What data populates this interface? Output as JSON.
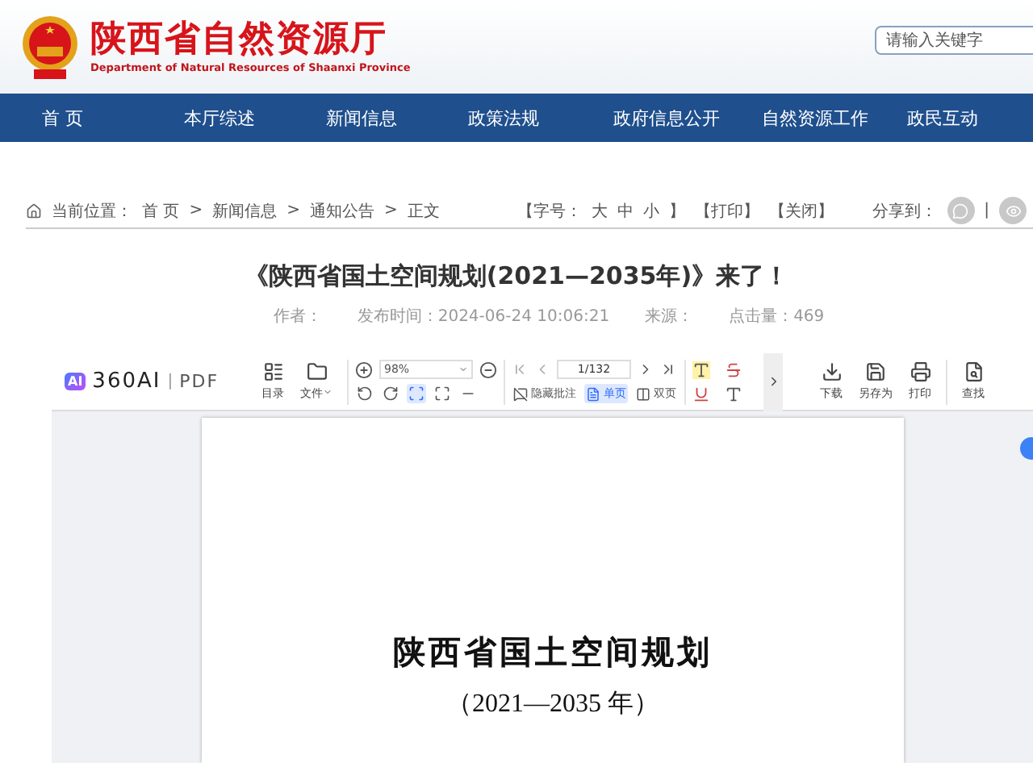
{
  "header": {
    "title": "陕西省自然资源厅",
    "subtitle": "Department of Natural Resources of Shaanxi Province",
    "search": {
      "placeholder": "请输入关键字"
    }
  },
  "nav": [
    {
      "label": "首 页"
    },
    {
      "label": "本厅综述"
    },
    {
      "label": "新闻信息"
    },
    {
      "label": "政策法规"
    },
    {
      "label": "政府信息公开"
    },
    {
      "label": "自然资源工作"
    },
    {
      "label": "政民互动"
    }
  ],
  "breadcrumb": {
    "label": "当前位置：",
    "separator": ">",
    "items": [
      "首 页",
      "新闻信息",
      "通知公告",
      "正文"
    ]
  },
  "tools": {
    "font_label": "【字号：",
    "sizes": [
      "大",
      "中",
      "小"
    ],
    "font_end": "】",
    "print": "【打印】",
    "close": "【关闭】",
    "share_label": "分享到：",
    "share_divider": "|"
  },
  "article": {
    "title": "《陕西省国土空间规划(2021—2035年)》来了！",
    "meta": [
      {
        "label": "作者："
      },
      {
        "label": "发布时间：",
        "value": "2024-06-24 10:06:21"
      },
      {
        "label": "来源："
      },
      {
        "label": "点击量：",
        "value": "469"
      }
    ]
  },
  "pdf": {
    "logo_badge": "AI",
    "logo_name": "360AI",
    "logo_divider": "|",
    "logo_suffix": "PDF",
    "file_buttons": [
      {
        "label": "目录",
        "kind": "toc"
      },
      {
        "label": "文件",
        "kind": "file"
      }
    ],
    "zoom": {
      "value": "98%"
    },
    "fit_buttons": [
      {
        "kind": "rotate-left",
        "selected": false
      },
      {
        "kind": "rotate-right",
        "selected": false
      },
      {
        "kind": "actual",
        "selected": true
      },
      {
        "kind": "fit",
        "selected": false
      },
      {
        "kind": "width",
        "selected": false
      }
    ],
    "page_field": {
      "value": "1/132"
    },
    "view_buttons": [
      {
        "label": "隐藏批注",
        "kind": "annot",
        "selected": false
      },
      {
        "label": "单页",
        "kind": "single",
        "selected": true
      },
      {
        "label": "双页",
        "kind": "double",
        "selected": false
      }
    ],
    "text_tools": [
      {
        "kind": "highlight"
      },
      {
        "kind": "strike"
      },
      {
        "kind": "underline"
      },
      {
        "kind": "plain"
      }
    ],
    "actions": [
      {
        "label": "下载",
        "kind": "download"
      },
      {
        "label": "另存为",
        "kind": "save"
      },
      {
        "label": "打印",
        "kind": "print"
      }
    ],
    "find": {
      "label": "查找"
    },
    "document": {
      "title": "陕西省国土空间规划",
      "subtitle": "（2021—2035 年）"
    }
  }
}
